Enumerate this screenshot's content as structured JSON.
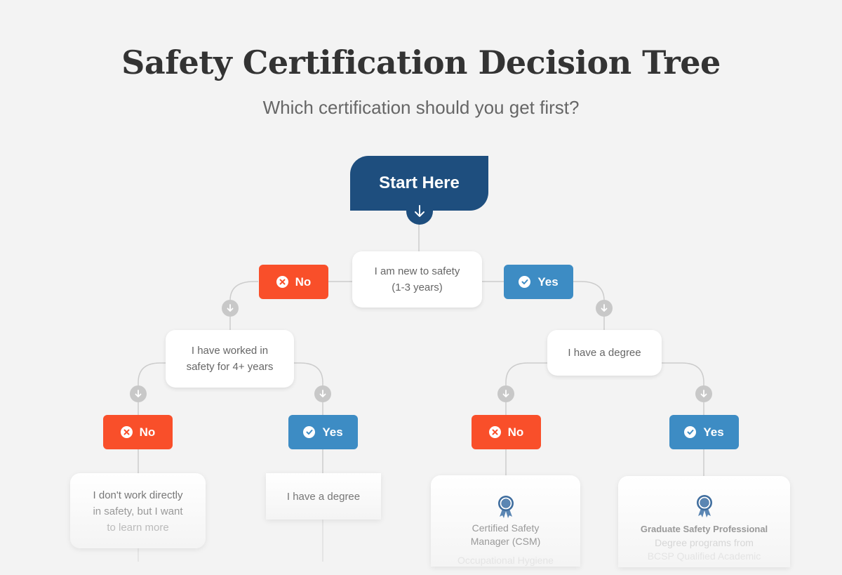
{
  "header": {
    "title": "Safety Certification Decision Tree",
    "subtitle": "Which certification should you get first?"
  },
  "colors": {
    "start": "#1e4e7e",
    "no": "#f94f2a",
    "yes": "#3d8cc4",
    "connector": "#c8c8c8",
    "background": "#f3f3f3"
  },
  "start": {
    "label": "Start Here",
    "icon": "arrow-down-icon"
  },
  "root_question": {
    "line1": "I am new to safety",
    "line2": "(1-3 years)"
  },
  "level1": {
    "no": {
      "label": "No",
      "icon": "x-circle-icon"
    },
    "yes": {
      "label": "Yes",
      "icon": "check-circle-icon"
    }
  },
  "level2": {
    "left_question": {
      "line1": "I have worked in",
      "line2": "safety for 4+ years"
    },
    "right_question": {
      "text": "I have a degree"
    }
  },
  "level3": {
    "left_no": {
      "label": "No",
      "icon": "x-circle-icon"
    },
    "left_yes": {
      "label": "Yes",
      "icon": "check-circle-icon"
    },
    "right_no": {
      "label": "No",
      "icon": "x-circle-icon"
    },
    "right_yes": {
      "label": "Yes",
      "icon": "check-circle-icon"
    }
  },
  "level4": {
    "left_no_card": {
      "line1": "I don't work directly",
      "line2": "in safety, but I want",
      "line3": "to learn more"
    },
    "left_yes_card": {
      "text": "I have a degree"
    },
    "right_no_card": {
      "icon": "award-ribbon-icon",
      "line1": "Certified Safety",
      "line2": "Manager (CSM)",
      "line3": "Occupational Hygiene"
    },
    "right_yes_card": {
      "icon": "award-ribbon-icon",
      "title": "Graduate Safety Professional",
      "line1": "Degree programs from",
      "line2": "BCSP Qualified Academic"
    }
  }
}
